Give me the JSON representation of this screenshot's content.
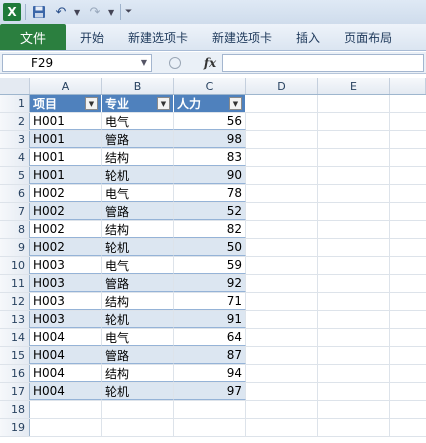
{
  "qat": {
    "app_icon_letter": "X",
    "undo_icon": "undo-icon",
    "redo_icon": "redo-icon",
    "save_icon": "save-icon"
  },
  "ribbon": {
    "file_tab": "文件",
    "tabs": [
      "开始",
      "新建选项卡",
      "新建选项卡",
      "插入",
      "页面布局"
    ]
  },
  "formula_bar": {
    "name_box": "F29",
    "fx_label": "fx",
    "formula": ""
  },
  "columns": [
    "A",
    "B",
    "C",
    "D",
    "E"
  ],
  "table": {
    "headers": [
      "项目",
      "专业",
      "人力"
    ],
    "rows": [
      [
        "H001",
        "电气",
        "56"
      ],
      [
        "H001",
        "管路",
        "98"
      ],
      [
        "H001",
        "结构",
        "83"
      ],
      [
        "H001",
        "轮机",
        "90"
      ],
      [
        "H002",
        "电气",
        "78"
      ],
      [
        "H002",
        "管路",
        "52"
      ],
      [
        "H002",
        "结构",
        "82"
      ],
      [
        "H002",
        "轮机",
        "50"
      ],
      [
        "H003",
        "电气",
        "59"
      ],
      [
        "H003",
        "管路",
        "92"
      ],
      [
        "H003",
        "结构",
        "71"
      ],
      [
        "H003",
        "轮机",
        "91"
      ],
      [
        "H004",
        "电气",
        "64"
      ],
      [
        "H004",
        "管路",
        "87"
      ],
      [
        "H004",
        "结构",
        "94"
      ],
      [
        "H004",
        "轮机",
        "97"
      ]
    ]
  },
  "row_numbers": [
    "1",
    "2",
    "3",
    "4",
    "5",
    "6",
    "7",
    "8",
    "9",
    "10",
    "11",
    "12",
    "13",
    "14",
    "15",
    "16",
    "17",
    "18",
    "19"
  ],
  "colors": {
    "table_header": "#4f81bd",
    "table_band": "#dce6f1",
    "file_tab": "#2b7f3f"
  }
}
